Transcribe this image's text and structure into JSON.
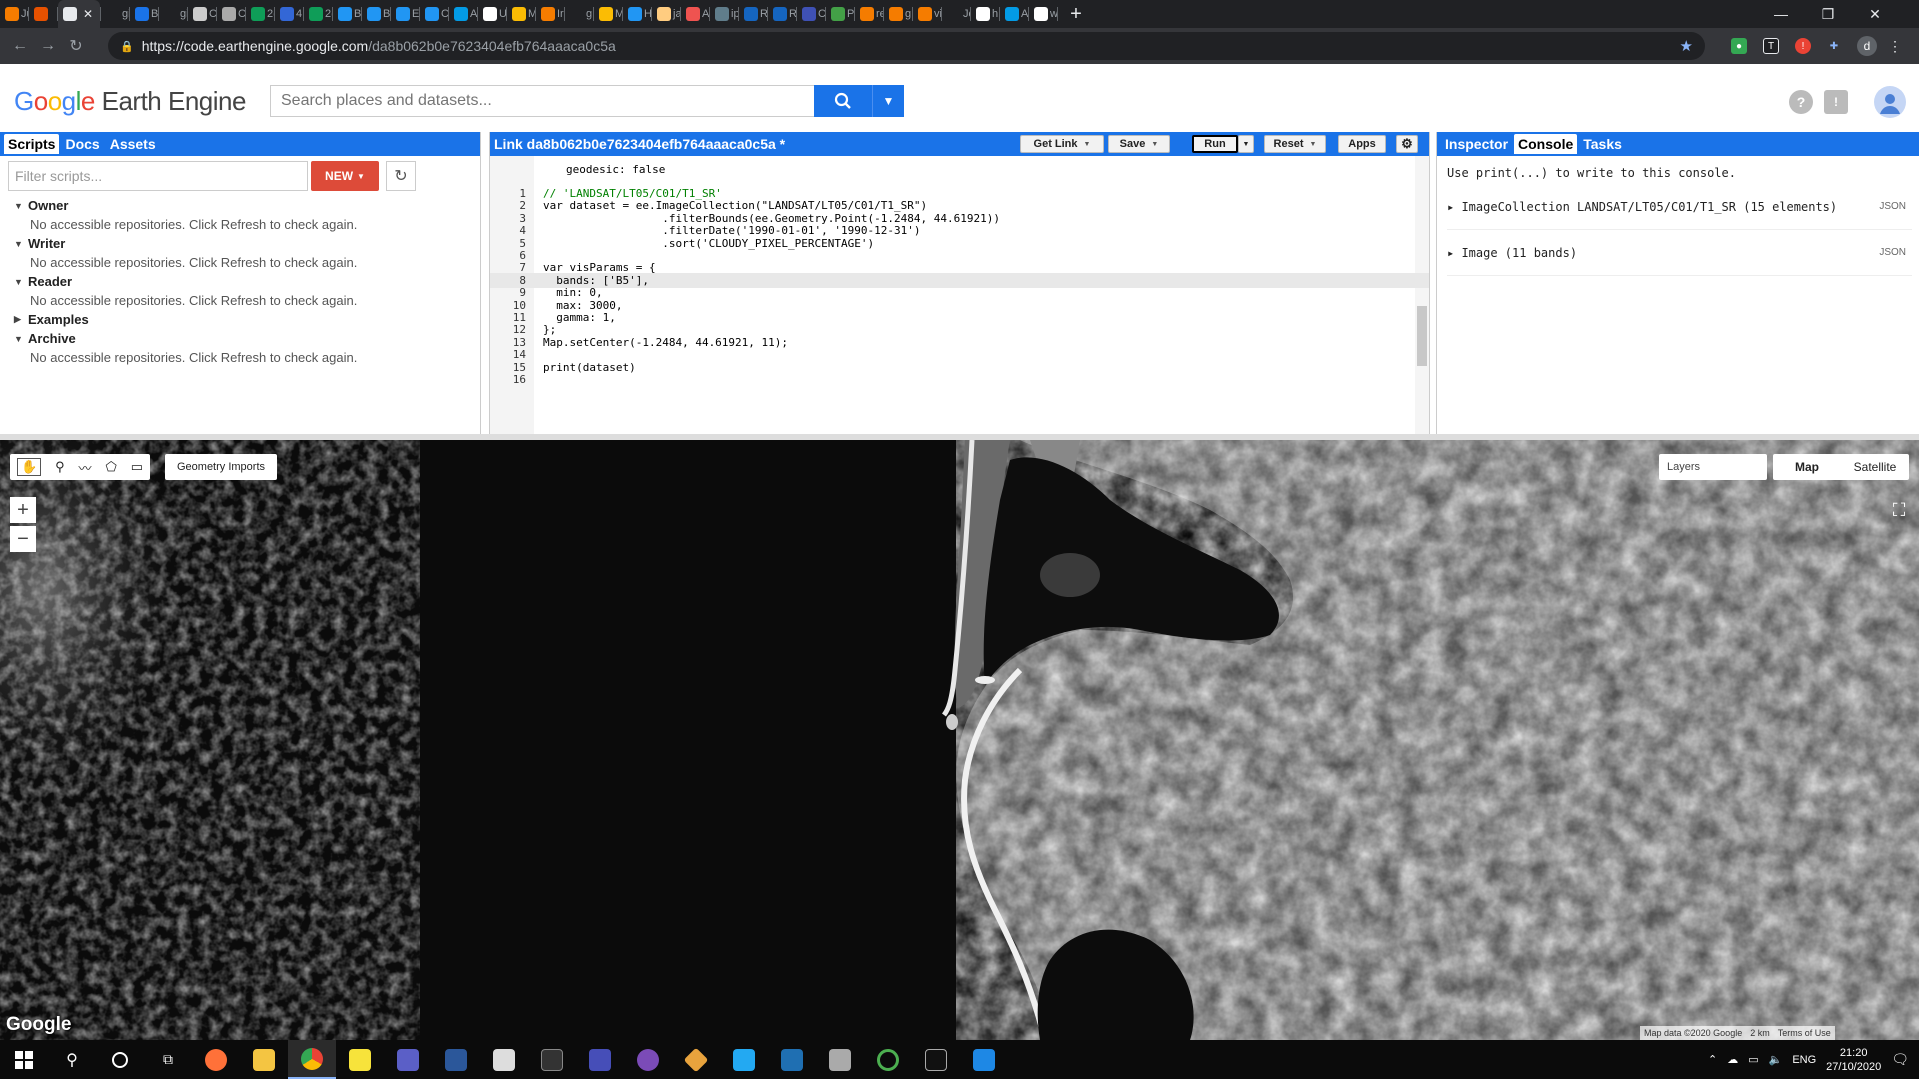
{
  "browser": {
    "tabs": [
      {
        "label": "Ju",
        "color": "#f57c00"
      },
      {
        "label": "",
        "color": "#e65100"
      },
      {
        "label": "",
        "color": "#e8eaed",
        "active": true
      },
      {
        "label": "gi",
        "color": "#202124"
      },
      {
        "label": "Bi",
        "color": "#1a73e8"
      },
      {
        "label": "gi",
        "color": "#202124"
      },
      {
        "label": "C",
        "color": "#cccccc"
      },
      {
        "label": "C",
        "color": "#aaaaaa"
      },
      {
        "label": "2(",
        "color": "#0f9d58"
      },
      {
        "label": "4",
        "color": "#3367d6"
      },
      {
        "label": "2(",
        "color": "#0f9d58"
      },
      {
        "label": "B",
        "color": "#2196f3"
      },
      {
        "label": "B",
        "color": "#2196f3"
      },
      {
        "label": "E",
        "color": "#2196f3"
      },
      {
        "label": "C",
        "color": "#2196f3"
      },
      {
        "label": "A",
        "color": "#039be5"
      },
      {
        "label": "U",
        "color": "#ffffff"
      },
      {
        "label": "M",
        "color": "#fbbc04"
      },
      {
        "label": "Ir",
        "color": "#f57c00"
      },
      {
        "label": "g",
        "color": "#202124"
      },
      {
        "label": "M",
        "color": "#fbbc04"
      },
      {
        "label": "H",
        "color": "#2196f3"
      },
      {
        "label": "ja",
        "color": "#ffcc80"
      },
      {
        "label": "A",
        "color": "#ef5350"
      },
      {
        "label": "ip",
        "color": "#607d8b"
      },
      {
        "label": "R",
        "color": "#1565c0"
      },
      {
        "label": "R",
        "color": "#1565c0"
      },
      {
        "label": "C",
        "color": "#3f51b5"
      },
      {
        "label": "P",
        "color": "#43a047"
      },
      {
        "label": "re",
        "color": "#f57c00"
      },
      {
        "label": "g",
        "color": "#f57c00"
      },
      {
        "label": "vi",
        "color": "#f57c00"
      },
      {
        "label": "Jc",
        "color": "#202124"
      },
      {
        "label": "h",
        "color": "#ffffff"
      },
      {
        "label": "A",
        "color": "#039be5"
      },
      {
        "label": "w",
        "color": "#ffffff"
      }
    ],
    "new_tab": "+",
    "url_host": "https://code.earthengine.google.com",
    "url_path": "/da8b062b0e7623404efb764aaaca0c5a",
    "profile_initial": "d",
    "window_controls": {
      "minimize": "—",
      "restore": "❐",
      "close": "✕"
    }
  },
  "header": {
    "logo_google": "Google",
    "logo_product": "Earth Engine",
    "search_placeholder": "Search places and datasets..."
  },
  "left_panel": {
    "tabs": [
      "Scripts",
      "Docs",
      "Assets"
    ],
    "filter_placeholder": "Filter scripts...",
    "new_label": "NEW",
    "tree": [
      {
        "name": "Owner",
        "expanded": true,
        "msg": "No accessible repositories. Click Refresh to check again."
      },
      {
        "name": "Writer",
        "expanded": true,
        "msg": "No accessible repositories. Click Refresh to check again."
      },
      {
        "name": "Reader",
        "expanded": true,
        "msg": "No accessible repositories. Click Refresh to check again."
      },
      {
        "name": "Examples",
        "expanded": false,
        "msg": ""
      },
      {
        "name": "Archive",
        "expanded": true,
        "msg": "No accessible repositories. Click Refresh to check again."
      }
    ]
  },
  "editor": {
    "title": "Link da8b062b0e7623404efb764aaaca0c5a *",
    "buttons": {
      "get_link": "Get Link",
      "save": "Save",
      "run": "Run",
      "reset": "Reset",
      "apps": "Apps"
    },
    "pre_line": "geodesic: false",
    "lines": [
      {
        "n": "1",
        "text": "// 'LANDSAT/LT05/C01/T1_SR'"
      },
      {
        "n": "2",
        "text": "var dataset = ee.ImageCollection(\"LANDSAT/LT05/C01/T1_SR\")"
      },
      {
        "n": "3",
        "text": "                  .filterBounds(ee.Geometry.Point(-1.2484, 44.61921))"
      },
      {
        "n": "4",
        "text": "                  .filterDate('1990-01-01', '1990-12-31')"
      },
      {
        "n": "5",
        "text": "                  .sort('CLOUDY_PIXEL_PERCENTAGE')"
      },
      {
        "n": "6",
        "text": ""
      },
      {
        "n": "7",
        "text": "var visParams = {"
      },
      {
        "n": "8",
        "text": "  bands: ['B5'],"
      },
      {
        "n": "9",
        "text": "  min: 0,"
      },
      {
        "n": "10",
        "text": "  max: 3000,"
      },
      {
        "n": "11",
        "text": "  gamma: 1,"
      },
      {
        "n": "12",
        "text": "};"
      },
      {
        "n": "13",
        "text": "Map.setCenter(-1.2484, 44.61921, 11);"
      },
      {
        "n": "14",
        "text": ""
      },
      {
        "n": "15",
        "text": "print(dataset)"
      },
      {
        "n": "16",
        "text": ""
      }
    ]
  },
  "right_panel": {
    "tabs": [
      "Inspector",
      "Console",
      "Tasks"
    ],
    "console_hint": "Use print(...) to write to this console.",
    "items": [
      {
        "label": "ImageCollection LANDSAT/LT05/C01/T1_SR (15 elements)",
        "tag": "JSON"
      },
      {
        "label": "Image (11 bands)",
        "tag": "JSON"
      }
    ]
  },
  "map": {
    "geometry_imports": "Geometry Imports",
    "zoom_in": "+",
    "zoom_out": "−",
    "layers": "Layers",
    "map_types": [
      "Map",
      "Satellite"
    ],
    "google_logo": "Google",
    "attribution": "Map data ©2020 Google",
    "scale": "2 km",
    "terms": "Terms of Use"
  },
  "taskbar": {
    "lang": "ENG",
    "time": "21:20",
    "date": "27/10/2020"
  }
}
